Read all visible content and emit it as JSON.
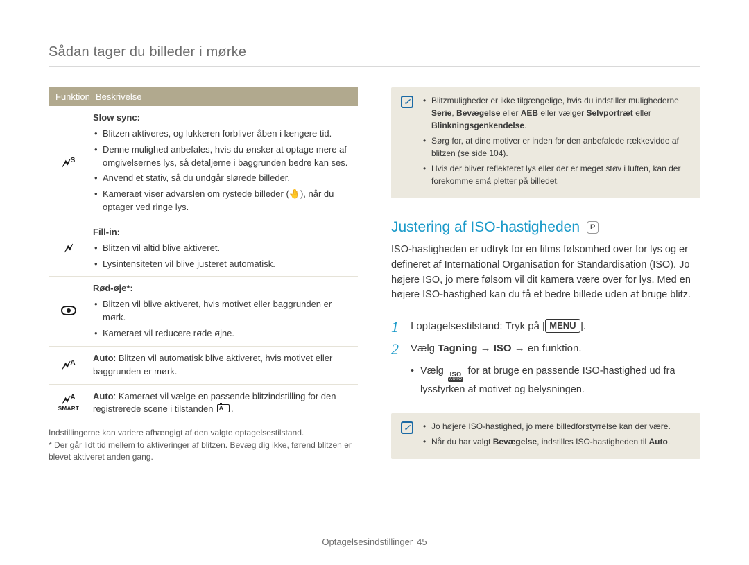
{
  "page_title": "Sådan tager du billeder i mørke",
  "table": {
    "headers": {
      "funktion": "Funktion",
      "beskrivelse": "Beskrivelse"
    },
    "rows": [
      {
        "icon": "flash-slow-sync",
        "title": "Slow sync:",
        "bullets": [
          "Blitzen aktiveres, og lukkeren forbliver åben i længere tid.",
          "Denne mulighed anbefales, hvis du ønsker at optage mere af omgivelsernes lys, så detaljerne i baggrunden bedre kan ses.",
          "Anvend et stativ, så du undgår slørede billeder.",
          "Kameraet viser advarslen om rystede billeder (🤚), når du optager ved ringe lys."
        ]
      },
      {
        "icon": "flash-fill",
        "title": "Fill-in:",
        "bullets": [
          "Blitzen vil altid blive aktiveret.",
          "Lysintensiteten vil blive justeret automatisk."
        ]
      },
      {
        "icon": "red-eye",
        "title": "Rød-øje*:",
        "bullets": [
          "Blitzen vil blive aktiveret, hvis motivet eller baggrunden er mørk.",
          "Kameraet vil reducere røde øjne."
        ]
      },
      {
        "icon": "flash-auto",
        "desc_prefix": "Auto",
        "desc": ": Blitzen vil automatisk blive aktiveret, hvis motivet eller baggrunden er mørk."
      },
      {
        "icon": "flash-auto-smart",
        "desc_prefix": "Auto",
        "desc": ": Kameraet vil vælge en passende blitzindstilling for den registrerede scene i tilstanden ",
        "trailing_icon": "scene-mode"
      }
    ]
  },
  "footnotes": {
    "line1": "Indstillingerne kan variere afhængigt af den valgte optagelsestilstand.",
    "line2": "* Der går lidt tid mellem to aktiveringer af blitzen. Bevæg dig ikke, førend blitzen er blevet aktiveret anden gang."
  },
  "note1": {
    "bullets": [
      {
        "pre": "Blitzmuligheder er ikke tilgængelige, hvis du indstiller mulighederne ",
        "bold1": "Serie",
        "mid1": ", ",
        "bold2": "Bevægelse",
        "mid2": " eller ",
        "bold3": "AEB",
        "mid3": " eller vælger ",
        "bold4": "Selvportræt",
        "mid4": " eller ",
        "bold5": "Blinkningsgenkendelse",
        "post": "."
      },
      {
        "text": "Sørg for, at dine motiver er inden for den anbefalede rækkevidde af blitzen (se side 104)."
      },
      {
        "text": "Hvis der bliver reflekteret lys eller der er meget støv i luften, kan der forekomme små pletter på billedet."
      }
    ]
  },
  "section": {
    "heading": "Justering af ISO-hastigheden",
    "mode_badge": "P",
    "intro": "ISO-hastigheden er udtryk for en films følsomhed over for lys og er defineret af International Organisation for Standardisation (ISO). Jo højere ISO, jo mere følsom vil dit kamera være over for lys. Med en højere ISO-hastighed kan du få et bedre billede uden at bruge blitz.",
    "step1": {
      "pre": "I optagelsestilstand: Tryk på [",
      "btn": "MENU",
      "post": "]."
    },
    "step2": {
      "pre": "Vælg ",
      "bold1": "Tagning",
      "arrow1": " → ",
      "bold2": "ISO",
      "post": " → en funktion."
    },
    "sub_bullet": {
      "pre": "Vælg ",
      "icon": "iso-auto",
      "post": " for at bruge en passende ISO-hastighed ud fra lysstyrken af motivet og belysningen."
    }
  },
  "note2": {
    "bullets": [
      {
        "text": "Jo højere ISO-hastighed, jo mere billedforstyrrelse kan der være."
      },
      {
        "pre": "Når du har valgt ",
        "bold": "Bevægelse",
        "mid": ", indstilles ISO-hastigheden til ",
        "bold2": "Auto",
        "post": "."
      }
    ]
  },
  "footer": {
    "label": "Optagelsesindstillinger",
    "page": "45"
  }
}
